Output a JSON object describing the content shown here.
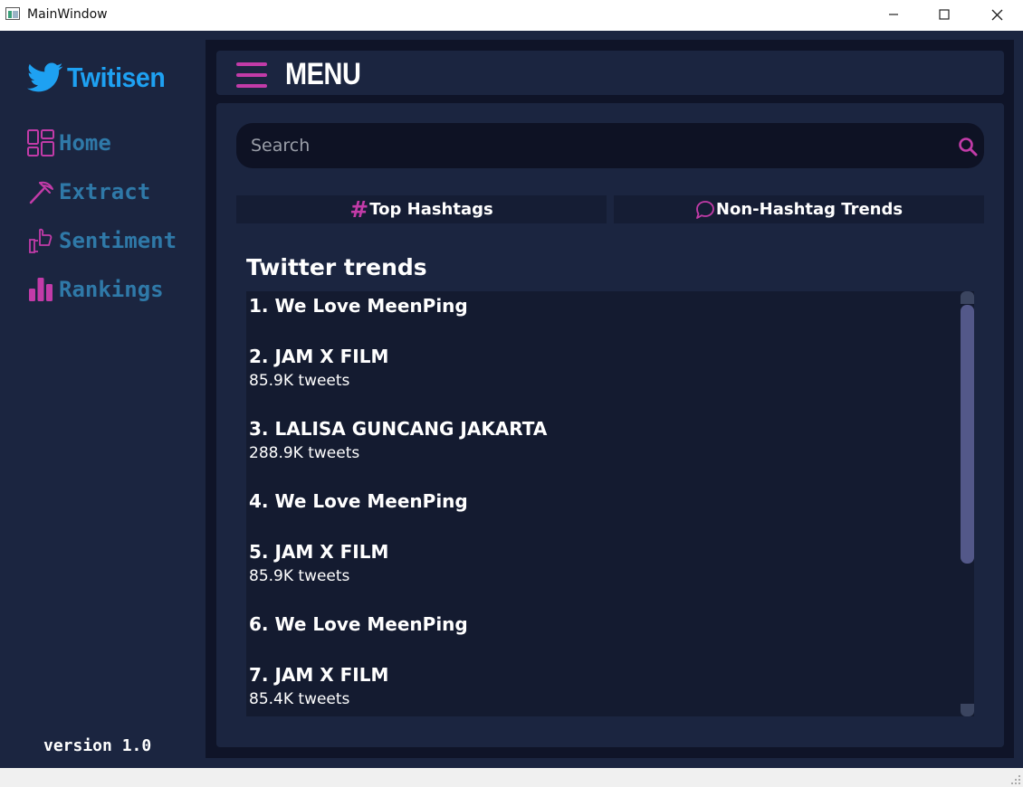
{
  "window": {
    "title": "MainWindow",
    "minimize_icon": "minimize-icon",
    "maximize_icon": "maximize-icon",
    "close_icon": "close-icon"
  },
  "sidebar": {
    "logo_text": "Twitisen",
    "logo_icon": "twitter-bird-icon",
    "items": [
      {
        "label": "Home",
        "icon": "dashboard-grid-icon"
      },
      {
        "label": "Extract",
        "icon": "pickaxe-icon"
      },
      {
        "label": "Sentiment",
        "icon": "thumbs-icon"
      },
      {
        "label": "Rankings",
        "icon": "bar-chart-icon"
      }
    ],
    "version": "version 1.0"
  },
  "header": {
    "menu_title": "MENU",
    "menu_icon": "hamburger-icon"
  },
  "search": {
    "placeholder": "Search",
    "value": ""
  },
  "tabs": [
    {
      "label": "Top Hashtags",
      "icon": "hash-icon"
    },
    {
      "label": "Non-Hashtag Trends",
      "icon": "speech-bubble-icon"
    }
  ],
  "trends": {
    "title": "Twitter trends",
    "items": [
      {
        "name": "1. We Love MeenPing",
        "count": ""
      },
      {
        "name": "2. JAM X FILM",
        "count": "85.9K tweets"
      },
      {
        "name": "3. LALISA GUNCANG JAKARTA",
        "count": "288.9K tweets"
      },
      {
        "name": "4. We Love MeenPing",
        "count": ""
      },
      {
        "name": "5. JAM X FILM",
        "count": "85.9K tweets"
      },
      {
        "name": "6. We Love MeenPing",
        "count": ""
      },
      {
        "name": "7. JAM X FILM",
        "count": "85.4K tweets"
      }
    ]
  },
  "colors": {
    "sidebar_bg": "#1b2540",
    "content_bg": "#0f1428",
    "accent_pink": "#c23ba8",
    "logo_blue": "#1ea1f2",
    "nav_text": "#2f79a8",
    "scroll_thumb": "#535889"
  }
}
